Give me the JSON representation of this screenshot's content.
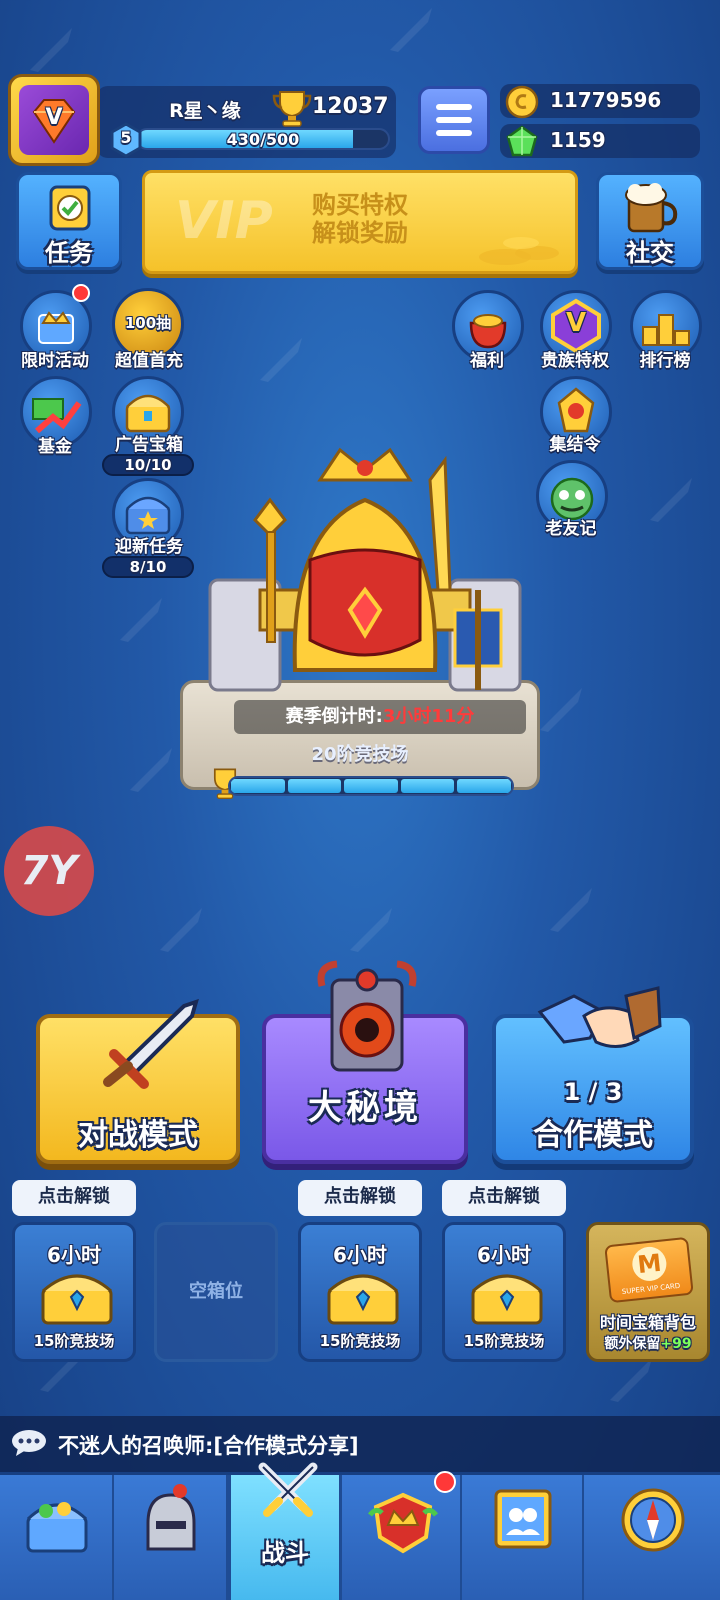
{
  "player": {
    "name": "R星丶缘",
    "trophies": "12037",
    "level": "5",
    "xp_text": "430/500",
    "xp_fraction": 0.86,
    "avatar_letter": "V"
  },
  "resources": {
    "gold": "11779596",
    "gems": "1159"
  },
  "top_actions": {
    "tasks_label": "任务",
    "vip_line1": "购买特权",
    "vip_line2": "解锁奖励",
    "vip_watermark": "VIP",
    "social_label": "社交"
  },
  "left_icons": [
    {
      "label": "限时活动",
      "icon": "crown-gift-icon",
      "dot": true
    },
    {
      "label": "超值首充",
      "icon": "hundred-draw-icon",
      "badge": "100抽"
    },
    {
      "label": "基金",
      "icon": "money-chart-icon"
    },
    {
      "label": "广告宝箱",
      "icon": "ad-chest-icon",
      "counter": "10/10"
    },
    {
      "label": "迎新任务",
      "icon": "newbie-chest-icon",
      "counter": "8/10"
    }
  ],
  "right_icons": [
    {
      "label": "福利",
      "icon": "gift-bag-icon"
    },
    {
      "label": "贵族特权",
      "icon": "noble-v-icon",
      "letter": "V"
    },
    {
      "label": "排行榜",
      "icon": "leaderboard-icon"
    },
    {
      "label": "集结令",
      "icon": "rally-emblem-icon"
    },
    {
      "label": "老友记",
      "icon": "old-friends-icon"
    }
  ],
  "arena": {
    "countdown_label": "赛季倒计时:",
    "countdown_value": "3小时11分",
    "name": "20阶竞技场",
    "progress_segments": 5
  },
  "floating_logo": "7Y",
  "modes": {
    "battle": "对战模式",
    "dungeon": "大秘境",
    "coop_count": "1 / 3",
    "coop": "合作模式"
  },
  "chests": [
    {
      "tag": "点击解锁",
      "time": "6小时",
      "arena": "15阶竞技场",
      "empty": false
    },
    {
      "tag": "",
      "time": "",
      "arena": "",
      "empty": true,
      "empty_label": "空箱位"
    },
    {
      "tag": "点击解锁",
      "time": "6小时",
      "arena": "15阶竞技场",
      "empty": false
    },
    {
      "tag": "点击解锁",
      "time": "6小时",
      "arena": "15阶竞技场",
      "empty": false
    }
  ],
  "vip_chest": {
    "card_text": "SUPER VIP CARD",
    "card_letter": "M",
    "title": "时间宝箱背包",
    "extra_label": "额外保留",
    "extra_value": "+99"
  },
  "chat": {
    "message": "不迷人的召唤师:[合作模式分享]"
  },
  "nav": {
    "items": [
      {
        "icon": "treasure-chest-icon",
        "label": ""
      },
      {
        "icon": "knight-helmet-icon",
        "label": ""
      },
      {
        "icon": "crossed-swords-icon",
        "label": "战斗"
      },
      {
        "icon": "crown-shield-icon",
        "label": ""
      },
      {
        "icon": "guild-banner-icon",
        "label": ""
      },
      {
        "icon": "compass-icon",
        "label": ""
      }
    ],
    "active_index": 2
  },
  "colors": {
    "background": "#2259a8",
    "gold_button": "#f5c22a",
    "purple_button": "#7a58e8",
    "blue_button": "#2f86e6",
    "countdown_red": "#ff3b3b",
    "bonus_green": "#7dff5a"
  }
}
